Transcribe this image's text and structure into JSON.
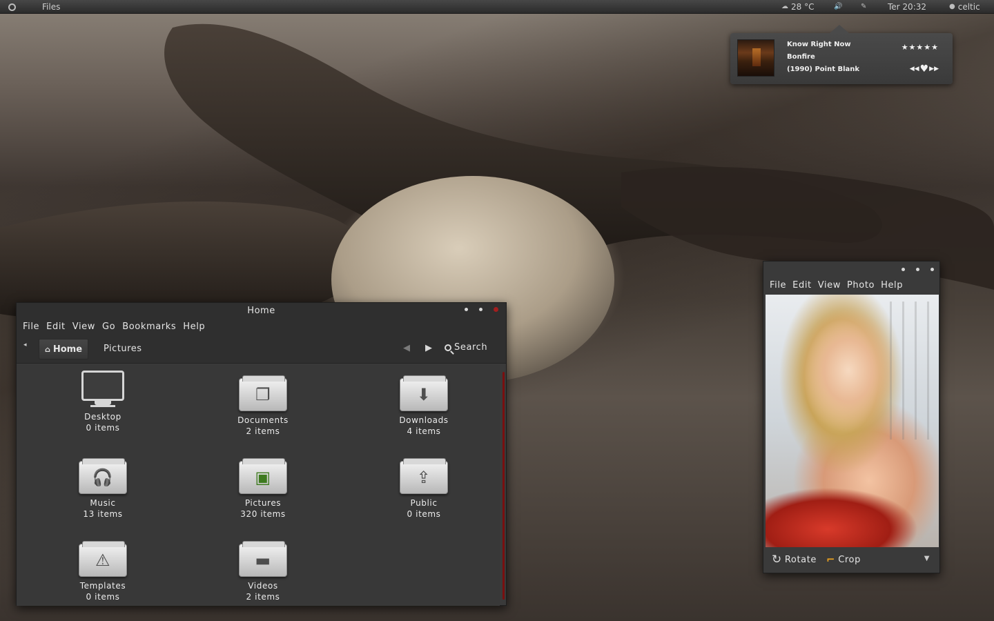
{
  "top_panel": {
    "app_name": "Files",
    "weather": "28 °C",
    "clock": "Ter 20:32",
    "user": "celtic"
  },
  "music": {
    "title": "Know Right Now",
    "artist": "Bonfire",
    "album": "(1990) Point Blank",
    "rating": "★★★★★",
    "prev": "◀◀",
    "love": "♥",
    "next": "▶▶"
  },
  "file_manager": {
    "title": "Home",
    "menu": [
      "File",
      "Edit",
      "View",
      "Go",
      "Bookmarks",
      "Help"
    ],
    "breadcrumbs": {
      "home": "Home",
      "pictures": "Pictures"
    },
    "search_label": "Search",
    "items": [
      {
        "name": "Desktop",
        "count": "0 items",
        "icon": "monitor-icon"
      },
      {
        "name": "Documents",
        "count": "2 items",
        "icon": "documents-icon"
      },
      {
        "name": "Downloads",
        "count": "4 items",
        "icon": "download-icon"
      },
      {
        "name": "Music",
        "count": "13 items",
        "icon": "headphones-icon"
      },
      {
        "name": "Pictures",
        "count": "320 items",
        "icon": "pictures-icon"
      },
      {
        "name": "Public",
        "count": "0 items",
        "icon": "share-icon"
      },
      {
        "name": "Templates",
        "count": "0 items",
        "icon": "template-icon"
      },
      {
        "name": "Videos",
        "count": "2 items",
        "icon": "clapperboard-icon"
      }
    ]
  },
  "photo_viewer": {
    "menu": [
      "File",
      "Edit",
      "View",
      "Photo",
      "Help"
    ],
    "rotate_label": "Rotate",
    "crop_label": "Crop"
  },
  "colors": {
    "panel": "#2b2b2b",
    "window": "#3a3a3a",
    "scrollbar": "#7a0f0f",
    "close_button": "#a31e1e",
    "crop_accent": "#e8a020"
  }
}
